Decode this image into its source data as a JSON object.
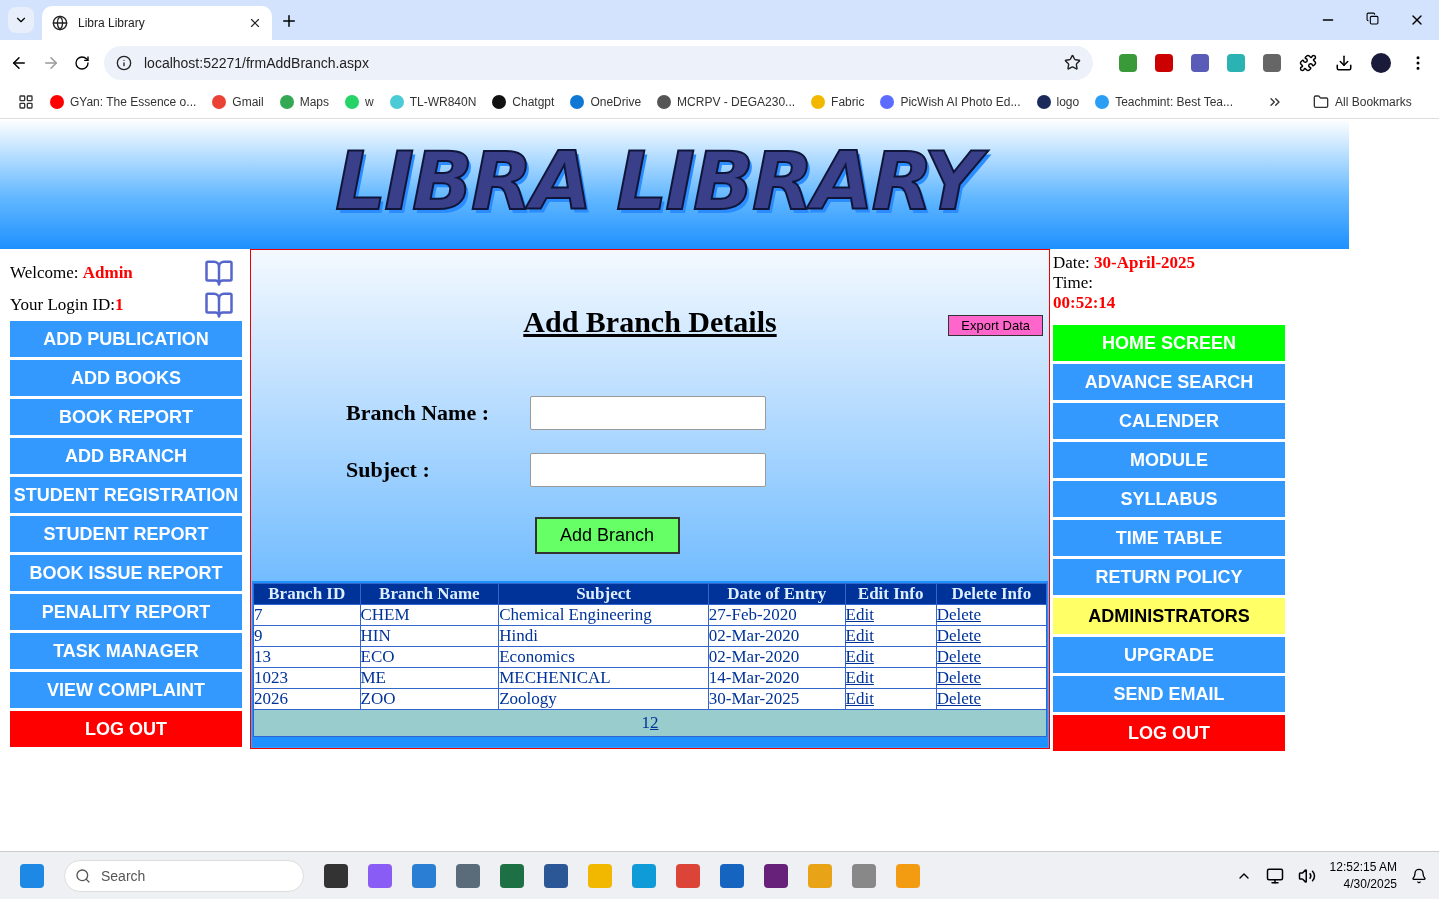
{
  "browser": {
    "tab_title": "Libra Library",
    "address": "localhost:52271/frmAddBranch.aspx",
    "bookmarks": [
      {
        "label": "GYan: The Essence o...",
        "color": "#ff0000"
      },
      {
        "label": "Gmail",
        "color": "#ea4335"
      },
      {
        "label": "Maps",
        "color": "#34a853"
      },
      {
        "label": "w",
        "color": "#25d366"
      },
      {
        "label": "TL-WR840N",
        "color": "#4acbd6"
      },
      {
        "label": "Chatgpt",
        "color": "#111111"
      },
      {
        "label": "OneDrive",
        "color": "#0f78d4"
      },
      {
        "label": "MCRPV - DEGA230...",
        "color": "#555555"
      },
      {
        "label": "Fabric",
        "color": "#f2b800"
      },
      {
        "label": "PicWish AI Photo Ed...",
        "color": "#5b6cff"
      },
      {
        "label": "logo",
        "color": "#1a2a5a"
      },
      {
        "label": "Teachmint: Best Tea...",
        "color": "#2a9df4"
      }
    ],
    "all_bookmarks": "All Bookmarks"
  },
  "banner": {
    "logo_text": "LIBRA LIBRARY"
  },
  "user": {
    "welcome_label": "Welcome:",
    "welcome_name": "Admin",
    "login_label": "Your Login ID:",
    "login_id": "1"
  },
  "left_menu": [
    {
      "label": "ADD PUBLICATION",
      "color": "#3399ff"
    },
    {
      "label": "ADD BOOKS",
      "color": "#3399ff"
    },
    {
      "label": "BOOK REPORT",
      "color": "#3399ff"
    },
    {
      "label": "ADD BRANCH",
      "color": "#3399ff"
    },
    {
      "label": "STUDENT REGISTRATION",
      "color": "#3399ff"
    },
    {
      "label": "STUDENT REPORT",
      "color": "#3399ff"
    },
    {
      "label": "BOOK ISSUE REPORT",
      "color": "#3399ff"
    },
    {
      "label": "PENALITY REPORT",
      "color": "#3399ff"
    },
    {
      "label": "TASK MANAGER",
      "color": "#3399ff"
    },
    {
      "label": "VIEW COMPLAINT",
      "color": "#3399ff"
    },
    {
      "label": "LOG OUT",
      "color": "#ff0000"
    }
  ],
  "form": {
    "title": "Add Branch Details",
    "export_button": "Export Data",
    "fields": [
      {
        "label": "Branch Name :"
      },
      {
        "label": "Subject :"
      }
    ],
    "submit_button": "Add Branch"
  },
  "table": {
    "columns": [
      "Branch ID",
      "Branch Name",
      "Subject",
      "Date of Entry",
      "Edit Info",
      "Delete Info"
    ],
    "rows": [
      [
        "7",
        "CHEM",
        "Chemical Engineering",
        "27-Feb-2020",
        "Edit",
        "Delete"
      ],
      [
        "9",
        "HIN",
        "Hindi",
        "02-Mar-2020",
        "Edit",
        "Delete"
      ],
      [
        "13",
        "ECO",
        "Economics",
        "02-Mar-2020",
        "Edit",
        "Delete"
      ],
      [
        "1023",
        "ME",
        "MECHENICAL",
        "14-Mar-2020",
        "Edit",
        "Delete"
      ],
      [
        "2026",
        "ZOO",
        "Zoology",
        "30-Mar-2025",
        "Edit",
        "Delete"
      ]
    ],
    "pages": [
      {
        "label": "1",
        "selected": true
      },
      {
        "label": "2",
        "selected": false
      }
    ]
  },
  "clock": {
    "date_label": "Date:",
    "date": "30-April-2025",
    "time_label": "Time:",
    "time": "00:52:14"
  },
  "right_menu": [
    {
      "label": "HOME SCREEN",
      "color": "#00ff00"
    },
    {
      "label": "ADVANCE SEARCH",
      "color": "#3399ff"
    },
    {
      "label": "CALENDER",
      "color": "#3399ff"
    },
    {
      "label": "MODULE",
      "color": "#3399ff"
    },
    {
      "label": "SYLLABUS",
      "color": "#3399ff"
    },
    {
      "label": "TIME TABLE",
      "color": "#3399ff"
    },
    {
      "label": "RETURN POLICY",
      "color": "#3399ff"
    },
    {
      "label": "ADMINISTRATORS",
      "color": "#ffff66"
    },
    {
      "label": "UPGRADE",
      "color": "#3399ff"
    },
    {
      "label": "SEND EMAIL",
      "color": "#3399ff"
    },
    {
      "label": "LOG OUT",
      "color": "#ff0000"
    }
  ],
  "taskbar": {
    "search_placeholder": "Search",
    "time": "12:52:15 AM",
    "date": "4/30/2025"
  }
}
